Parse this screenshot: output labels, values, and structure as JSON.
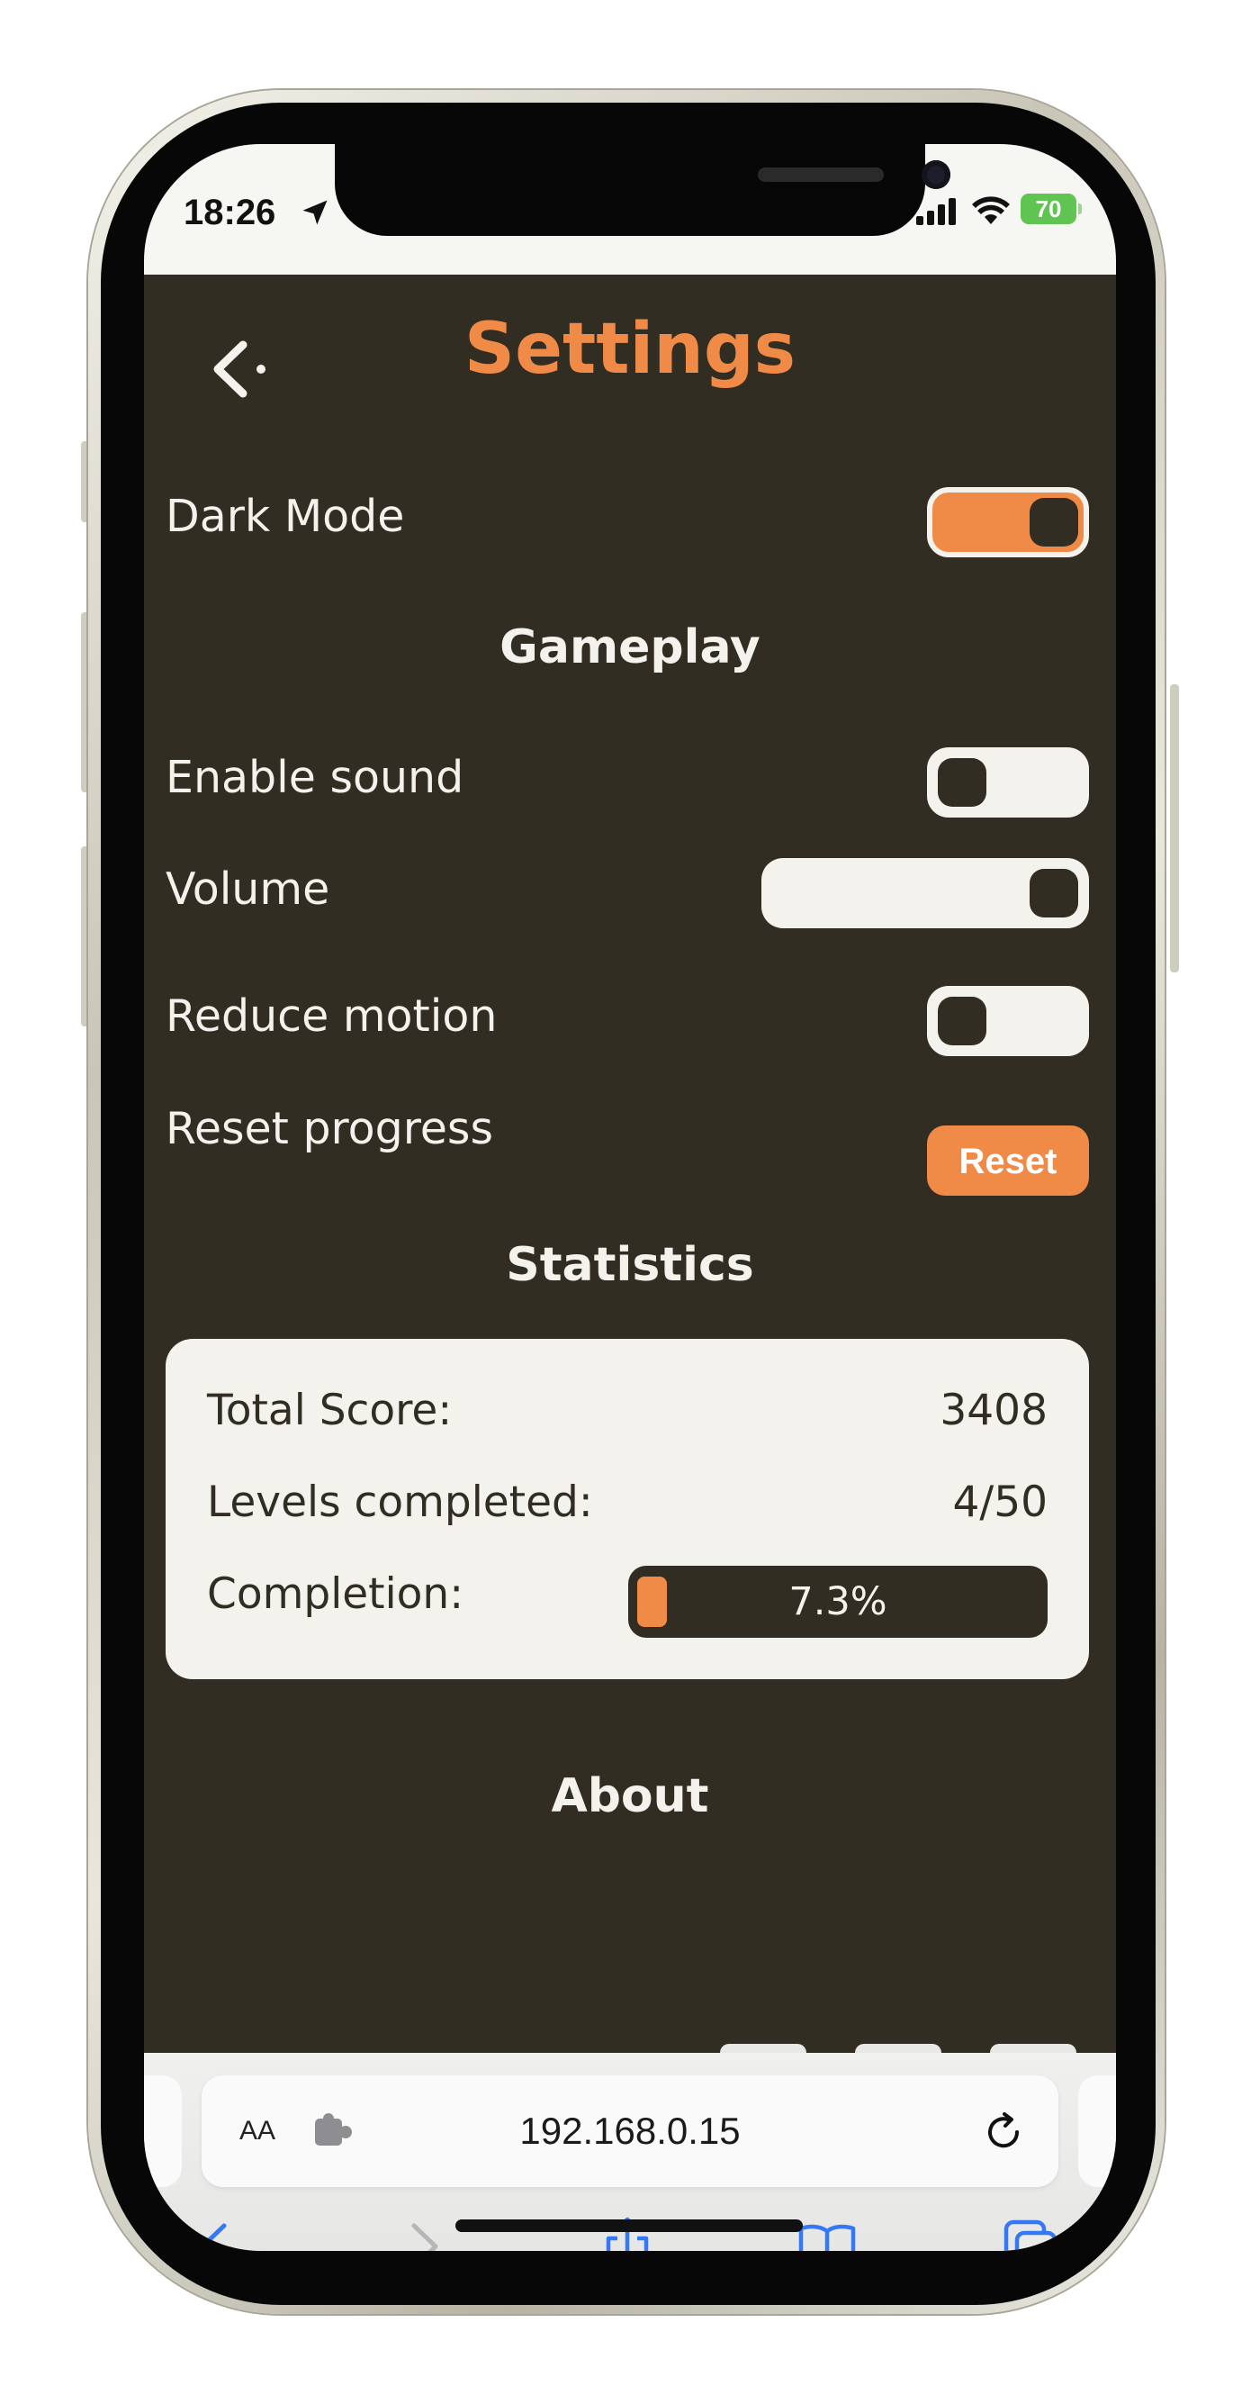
{
  "status_bar": {
    "time": "18:26",
    "battery": "70"
  },
  "app": {
    "title": "Settings",
    "dark_mode": {
      "label": "Dark Mode",
      "on": true
    },
    "sections": {
      "gameplay": "Gameplay",
      "statistics": "Statistics",
      "about": "About"
    },
    "enable_sound": {
      "label": "Enable sound",
      "on": false
    },
    "volume": {
      "label": "Volume",
      "level": 1.0
    },
    "reduce_motion": {
      "label": "Reduce motion",
      "on": false
    },
    "reset_progress": {
      "label": "Reset progress",
      "button": "Reset"
    },
    "stats": {
      "total_score_label": "Total Score:",
      "total_score": "3408",
      "levels_label": "Levels completed:",
      "levels": "4/50",
      "completion_label": "Completion:",
      "completion_text": "7.3%",
      "completion_fraction": 0.073
    }
  },
  "browser": {
    "aa_label": "AA",
    "url": "192.168.0.15"
  },
  "colors": {
    "accent": "#ef8a47",
    "background": "#312d22",
    "foreground": "#f4f2ec",
    "link_blue": "#3478f6"
  },
  "icons": [
    "location-arrow-icon",
    "cellular-signal-icon",
    "wifi-icon",
    "battery-icon",
    "back-chevron-icon",
    "extension-icon",
    "reload-icon",
    "back-arrow-icon",
    "forward-arrow-icon",
    "share-icon",
    "bookmarks-icon",
    "tabs-icon"
  ]
}
